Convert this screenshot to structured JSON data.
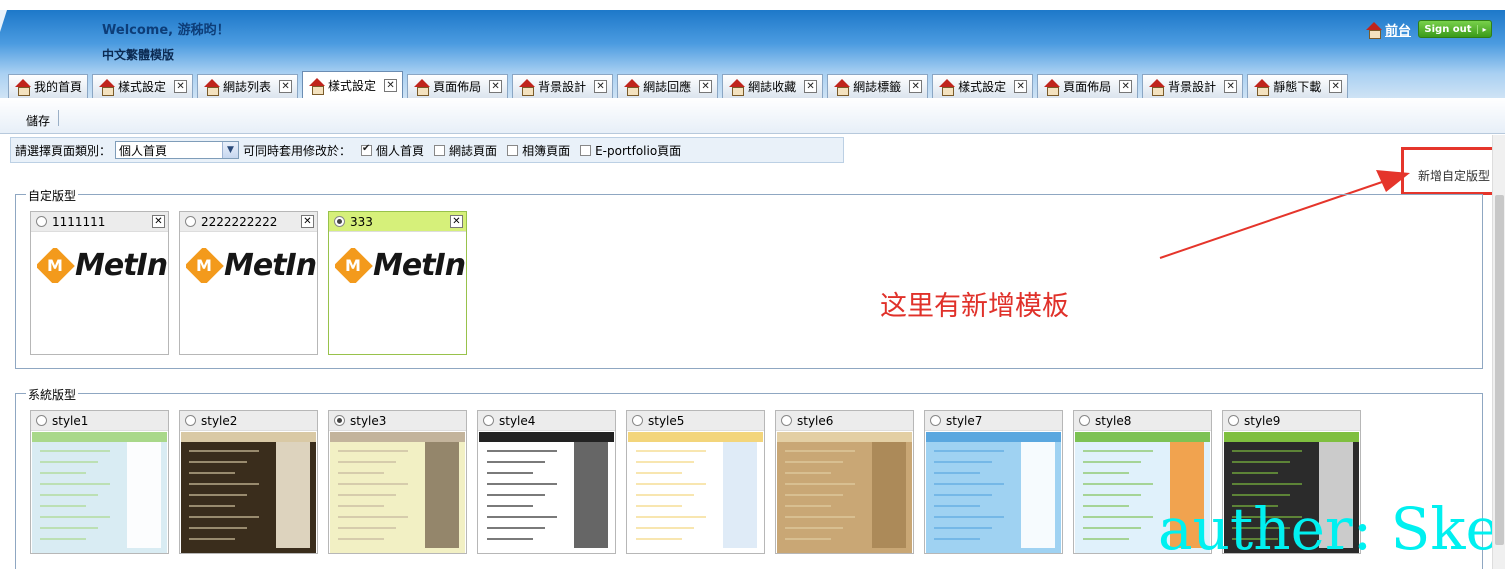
{
  "header": {
    "welcome_label": "Welcome, 游秭昀！",
    "template_name": "中文繁體模版",
    "home_link": "前台",
    "signout": "Sign out"
  },
  "tabs": [
    {
      "label": "我的首頁",
      "closable": false,
      "active": false
    },
    {
      "label": "樣式設定",
      "closable": true,
      "active": false
    },
    {
      "label": "網誌列表",
      "closable": true,
      "active": false
    },
    {
      "label": "樣式設定",
      "closable": true,
      "active": true
    },
    {
      "label": "頁面佈局",
      "closable": true,
      "active": false
    },
    {
      "label": "背景設計",
      "closable": true,
      "active": false
    },
    {
      "label": "網誌回應",
      "closable": true,
      "active": false
    },
    {
      "label": "網誌收藏",
      "closable": true,
      "active": false
    },
    {
      "label": "網誌標籤",
      "closable": true,
      "active": false
    },
    {
      "label": "樣式設定",
      "closable": true,
      "active": false
    },
    {
      "label": "頁面佈局",
      "closable": true,
      "active": false
    },
    {
      "label": "背景設計",
      "closable": true,
      "active": false
    },
    {
      "label": "靜態下載",
      "closable": true,
      "active": false
    }
  ],
  "toolbar": {
    "save_label": "儲存"
  },
  "filter": {
    "label": "請選擇頁面類別：",
    "selected": "個人首頁",
    "apply_label": "可同時套用修改於：",
    "options": [
      {
        "label": "個人首頁",
        "checked": true
      },
      {
        "label": "網誌頁面",
        "checked": false
      },
      {
        "label": "相簿頁面",
        "checked": false
      },
      {
        "label": "E-portfolio頁面",
        "checked": false
      }
    ]
  },
  "new_template_label": "新增自定版型",
  "custom_section": {
    "legend": "自定版型",
    "logo_text": "MetIn",
    "logo_letter": "M",
    "items": [
      {
        "name": "1111111",
        "selected": false
      },
      {
        "name": "2222222222",
        "selected": false
      },
      {
        "name": "333",
        "selected": true
      }
    ]
  },
  "system_section": {
    "legend": "系統版型",
    "items": [
      {
        "name": "style1",
        "selected": false,
        "colors": [
          "#d9ecf3",
          "#a9d88a",
          "#ffffff"
        ]
      },
      {
        "name": "style2",
        "selected": false,
        "colors": [
          "#3a2d1c",
          "#d9c9a5",
          "#efe6d0"
        ]
      },
      {
        "name": "style3",
        "selected": true,
        "colors": [
          "#f2f0c4",
          "#c3b49c",
          "#8a7a62"
        ]
      },
      {
        "name": "style4",
        "selected": false,
        "colors": [
          "#ffffff",
          "#222222",
          "#555555"
        ]
      },
      {
        "name": "style5",
        "selected": false,
        "colors": [
          "#ffffff",
          "#f3d57b",
          "#dbe9f6"
        ]
      },
      {
        "name": "style6",
        "selected": false,
        "colors": [
          "#c9a775",
          "#e3cfa4",
          "#a88757"
        ]
      },
      {
        "name": "style7",
        "selected": false,
        "colors": [
          "#9fd2f2",
          "#5aa7df",
          "#ffffff"
        ]
      },
      {
        "name": "style8",
        "selected": false,
        "colors": [
          "#e0f1fb",
          "#7dc253",
          "#f39a3c"
        ]
      },
      {
        "name": "style9",
        "selected": false,
        "colors": [
          "#2b2b2b",
          "#7fbf3f",
          "#dddddd"
        ]
      }
    ]
  },
  "annotation": "这里有新增模板",
  "watermark": "auther: Ske"
}
